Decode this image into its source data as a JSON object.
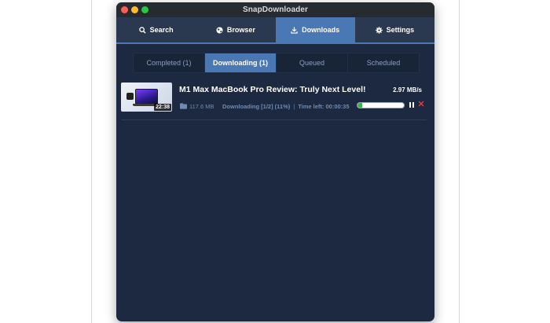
{
  "window": {
    "title": "SnapDownloader"
  },
  "nav": {
    "items": [
      {
        "label": "Search",
        "icon": "search-icon",
        "active": false
      },
      {
        "label": "Browser",
        "icon": "globe-icon",
        "active": false
      },
      {
        "label": "Downloads",
        "icon": "download-icon",
        "active": true
      },
      {
        "label": "Settings",
        "icon": "gear-icon",
        "active": false
      }
    ]
  },
  "subtabs": [
    {
      "label": "Completed (1)",
      "active": false
    },
    {
      "label": "Downloading (1)",
      "active": true
    },
    {
      "label": "Queued",
      "active": false
    },
    {
      "label": "Scheduled",
      "active": false
    }
  ],
  "download": {
    "title": "M1 Max MacBook Pro Review: Truly Next Level!",
    "duration": "22:38",
    "speed": "2.97 MB/s",
    "file_size": "117.6 MB",
    "status": "Downloading [1/2] (11%)",
    "separator": "|",
    "time_left": "Time left: 00:00:35",
    "progress_percent": 11
  },
  "colors": {
    "window_bg": "#1c2940",
    "accent": "#4a78b4",
    "progress": "#3fb34a",
    "cancel": "#e23a3a"
  }
}
